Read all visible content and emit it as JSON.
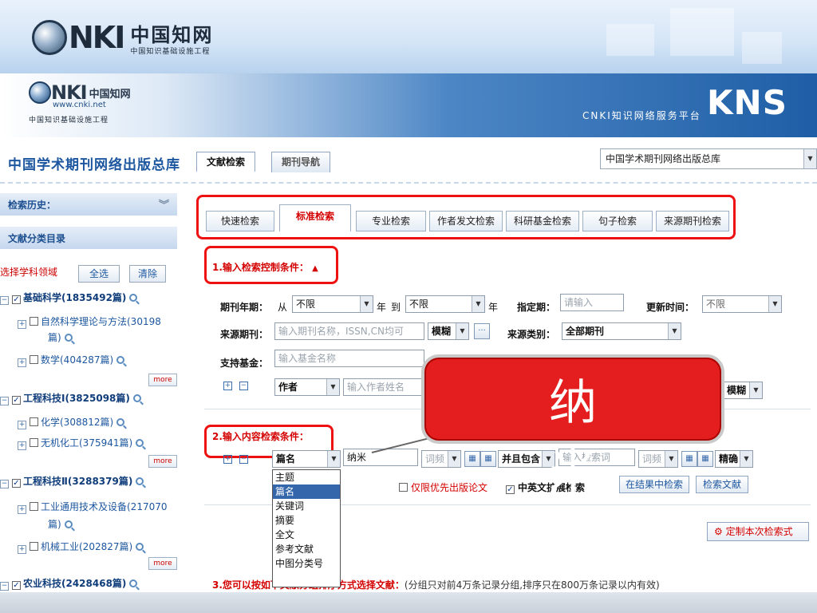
{
  "brand": {
    "logo_mark": "NKI",
    "logo_cn": "中国知网",
    "logo_sub": "中国知识基础设施工程",
    "small_logo_cn": "中国知网",
    "small_logo_url": "www.cnki.net",
    "small_logo_sub": "中国知识基础设施工程",
    "platform_text": "CNKI知识网络服务平台",
    "kns": "KNS"
  },
  "header": {
    "db_title": "中国学术期刊网络出版总库",
    "tabs": [
      "文献检索",
      "期刊导航"
    ],
    "db_select": "中国学术期刊网络出版总库"
  },
  "sidebar": {
    "history": "检索历史：",
    "category": "文献分类目录",
    "subject_label": "选择学科领域",
    "select_all": "全选",
    "clear": "清除",
    "more": "more",
    "items": [
      {
        "text": "基础科学(1835492篇)"
      },
      {
        "text": "自然科学理论与方法(30198"
      },
      {
        "text": "篇)"
      },
      {
        "text": "数学(404287篇)"
      },
      {
        "text": "工程科技Ⅰ(3825098篇)"
      },
      {
        "text": "化学(308812篇)"
      },
      {
        "text": "无机化工(375941篇)"
      },
      {
        "text": "工程科技Ⅱ(3288379篇)"
      },
      {
        "text": "工业通用技术及设备(217070"
      },
      {
        "text": "篇)"
      },
      {
        "text": "机械工业(202827篇)"
      },
      {
        "text": "农业科技(2428468篇)"
      }
    ]
  },
  "search_tabs": [
    "快速检索",
    "标准检索",
    "专业检索",
    "作者发文检索",
    "科研基金检索",
    "句子检索",
    "来源期刊检索"
  ],
  "section1": {
    "title": "1.输入检索控制条件：",
    "year_label": "期刊年期：",
    "from": "从",
    "year_from": "不限",
    "year": "年",
    "to": "到",
    "year_to": "不限",
    "year2": "年",
    "period_label": "指定期：",
    "period_placeholder": "请输入",
    "update_label": "更新时间：",
    "update_value": "不限",
    "source_label": "来源期刊：",
    "source_placeholder": "输入期刊名称，ISSN,CN均可",
    "match_fuzzy": "模糊",
    "source_type_label": "来源类别：",
    "source_type": "全部期刊",
    "fund_label": "支持基金：",
    "fund_placeholder": "输入基金名称",
    "author_field": "作者",
    "author_placeholder": "输入作者姓名",
    "author_match": "模糊"
  },
  "section2": {
    "title": "2.输入内容检索条件：",
    "field": "篇名",
    "keyword": "纳米",
    "freq": "词频",
    "logic": "并且包含",
    "keyword2_placeholder": "输入检索词",
    "freq2": "词频",
    "precision": "精确",
    "priority_label": "仅限优先出版论文",
    "bilingual_label": "中英文扩展检索",
    "search_in_results": "在结果中检索",
    "search_btn": "检索文献",
    "customize": "定制本次检索式"
  },
  "dropdown_options": [
    "主题",
    "篇名",
    "关键词",
    "摘要",
    "全文",
    "参考文献",
    "中图分类号"
  ],
  "callout": "纳米",
  "section3": {
    "title": "3.您可以按如下文献分组排序方式选择文献：",
    "note": "(分组只对前4万条记录分组,排序只在800万条记录以内有效)"
  },
  "colors": {
    "brand_blue": "#1d57a0",
    "accent_red": "#d40000",
    "highlight_red": "#e41e1e"
  }
}
